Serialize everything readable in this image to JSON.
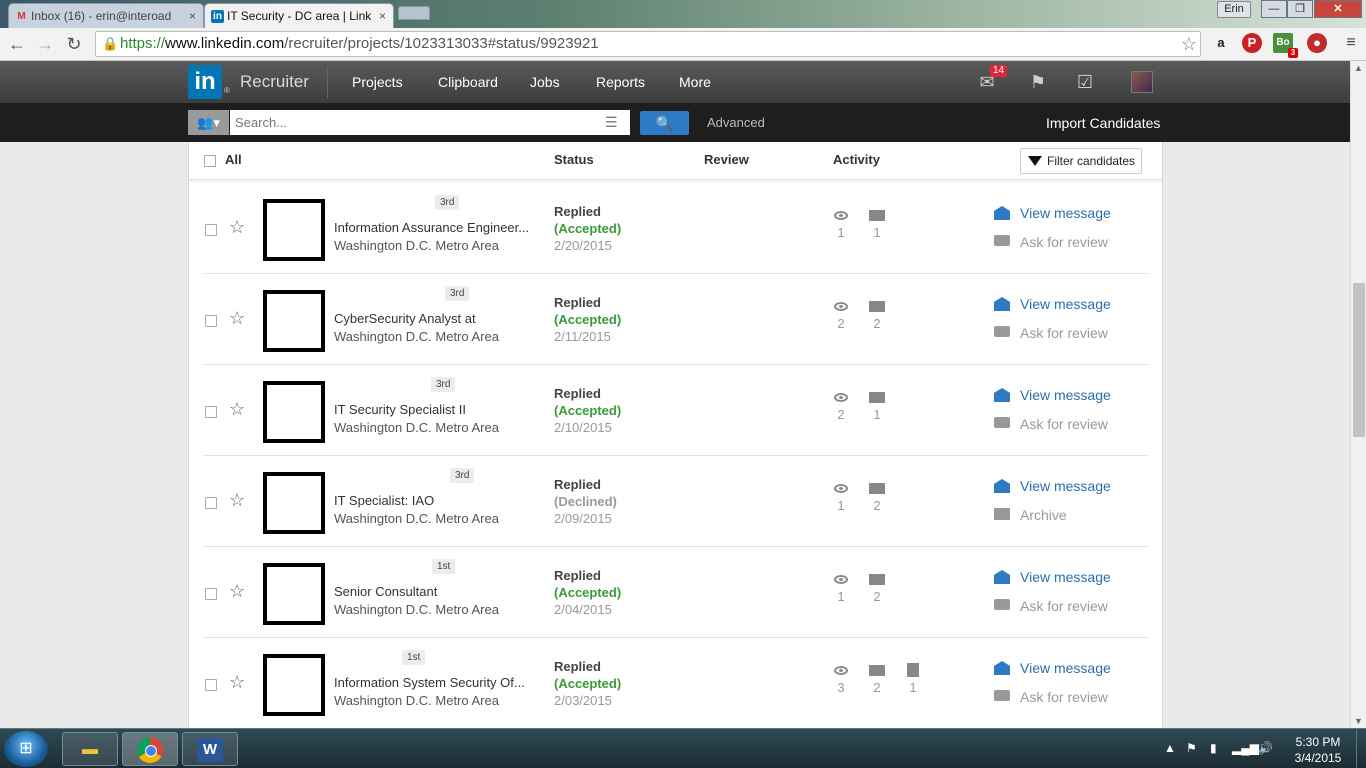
{
  "browser": {
    "tabs": [
      {
        "label": "Inbox (16) - erin@interoad",
        "favicon": "gmail-icon",
        "active": false
      },
      {
        "label": "IT Security - DC area | Link",
        "favicon": "linkedin-icon",
        "active": true
      }
    ],
    "tab_close": "×",
    "user_chip": "Erin",
    "window_buttons": {
      "min": "—",
      "max": "❐",
      "close": "✕"
    },
    "url_scheme": "https://",
    "url_host": "www.linkedin.com",
    "url_path": "/recruiter/projects/1023313033#status/9923921",
    "extensions": {
      "amazon": "a",
      "pinterest": "P",
      "boa": "Bo",
      "boa_count": "3",
      "lastpass": "●"
    }
  },
  "header": {
    "logo": "in",
    "logo_reg": "®",
    "brand": "Recruiter",
    "nav": [
      "Projects",
      "Clipboard",
      "Jobs",
      "Reports",
      "More"
    ],
    "mail_badge": "14"
  },
  "search": {
    "placeholder": "Search...",
    "advanced": "Advanced",
    "import": "Import Candidates"
  },
  "list_header": {
    "all": "All",
    "status": "Status",
    "review": "Review",
    "activity": "Activity",
    "filter": "Filter candidates"
  },
  "candidates": [
    {
      "degree": "3rd",
      "title": "Information Assurance Engineer...",
      "location": "Washington D.C. Metro Area",
      "status": "Replied",
      "substatus": "(Accepted)",
      "date": "2/20/2015",
      "views": "1",
      "messages": "1",
      "notes": "",
      "action1": "View message",
      "action2": "Ask for review"
    },
    {
      "degree": "3rd",
      "title": "CyberSecurity Analyst at",
      "location": "Washington D.C. Metro Area",
      "status": "Replied",
      "substatus": "(Accepted)",
      "date": "2/11/2015",
      "views": "2",
      "messages": "2",
      "notes": "",
      "action1": "View message",
      "action2": "Ask for review"
    },
    {
      "degree": "3rd",
      "title": "IT Security Specialist II",
      "location": "Washington D.C. Metro Area",
      "status": "Replied",
      "substatus": "(Accepted)",
      "date": "2/10/2015",
      "views": "2",
      "messages": "1",
      "notes": "",
      "action1": "View message",
      "action2": "Ask for review"
    },
    {
      "degree": "3rd",
      "title": "IT Specialist: IAO",
      "location": "Washington D.C. Metro Area",
      "status": "Replied",
      "substatus": "(Declined)",
      "date": "2/09/2015",
      "views": "1",
      "messages": "2",
      "notes": "",
      "action1": "View message",
      "action2": "Archive"
    },
    {
      "degree": "1st",
      "title": "Senior Consultant",
      "location": "Washington D.C. Metro Area",
      "status": "Replied",
      "substatus": "(Accepted)",
      "date": "2/04/2015",
      "views": "1",
      "messages": "2",
      "notes": "",
      "action1": "View message",
      "action2": "Ask for review"
    },
    {
      "degree": "1st",
      "title": "Information System Security Of...",
      "location": "Washington D.C. Metro Area",
      "status": "Replied",
      "substatus": "(Accepted)",
      "date": "2/03/2015",
      "views": "3",
      "messages": "2",
      "notes": "1",
      "action1": "View message",
      "action2": "Ask for review"
    }
  ],
  "taskbar": {
    "start": "⊞",
    "word": "W",
    "time": "5:30 PM",
    "date": "3/4/2015",
    "tray": [
      "▲",
      "⚑",
      "▮",
      "▂▄▆",
      "🔊"
    ]
  }
}
